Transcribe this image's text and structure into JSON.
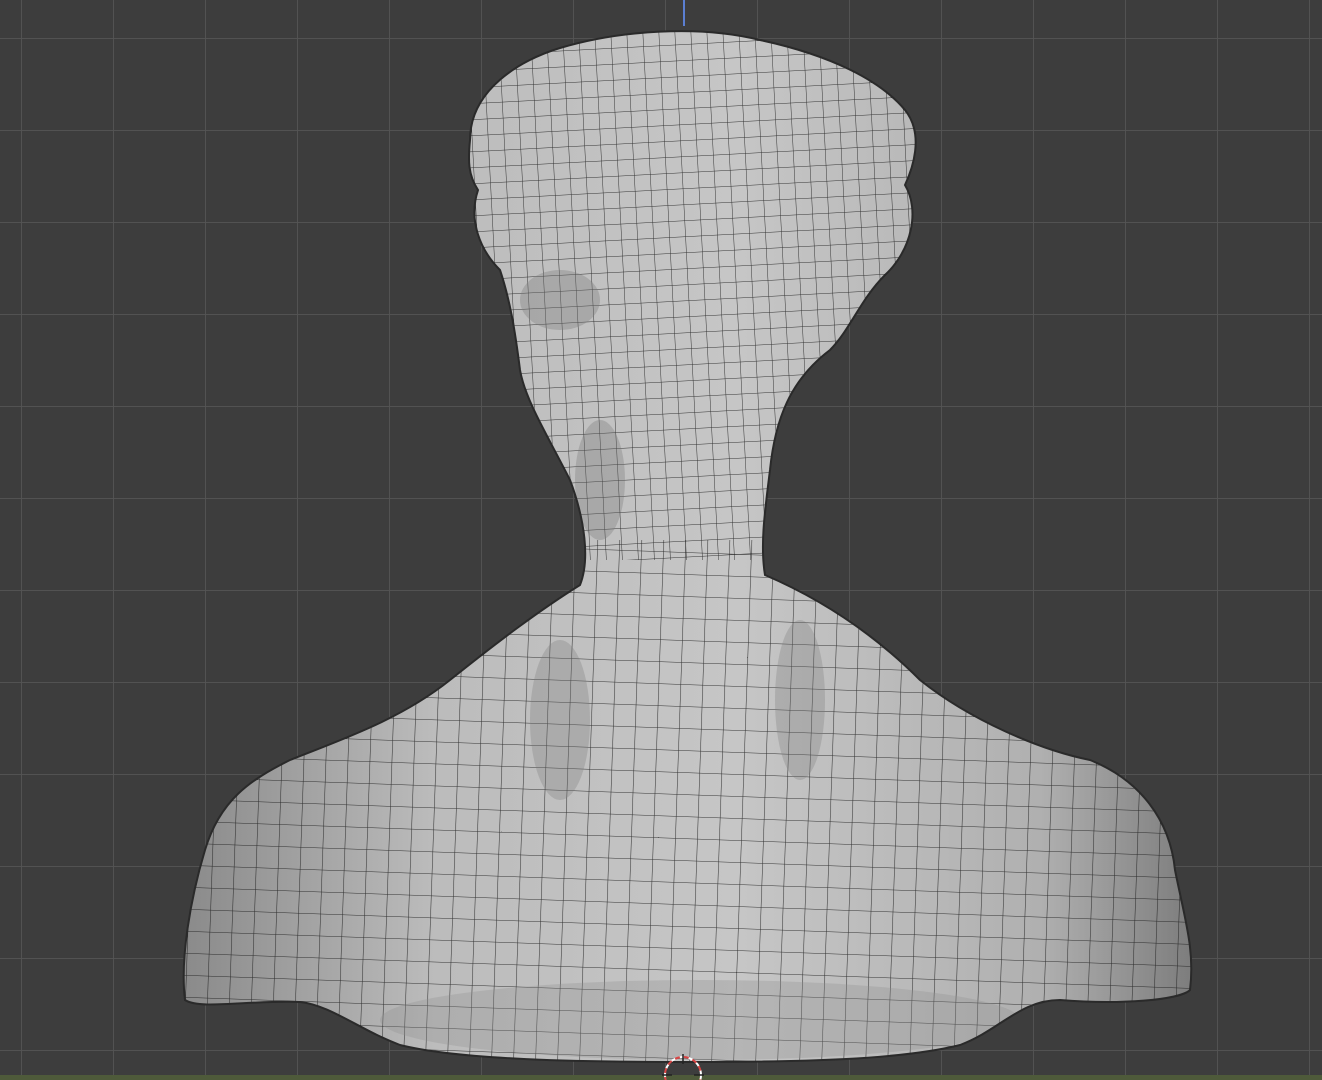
{
  "viewport": {
    "mode": "solid-wireframe-overlay",
    "background_color": "#3d3d3d",
    "grid_color": "#545454",
    "z_axis_color": "#5b7fd2",
    "mesh_fill_color": "#bdbdbd",
    "mesh_wire_color": "#1b1b1b"
  },
  "model": {
    "icon": "sculpted-bust-mesh"
  },
  "cursor_3d": {
    "icon": "3d-cursor-icon",
    "colors": [
      "#d94545",
      "#ffffff"
    ]
  }
}
